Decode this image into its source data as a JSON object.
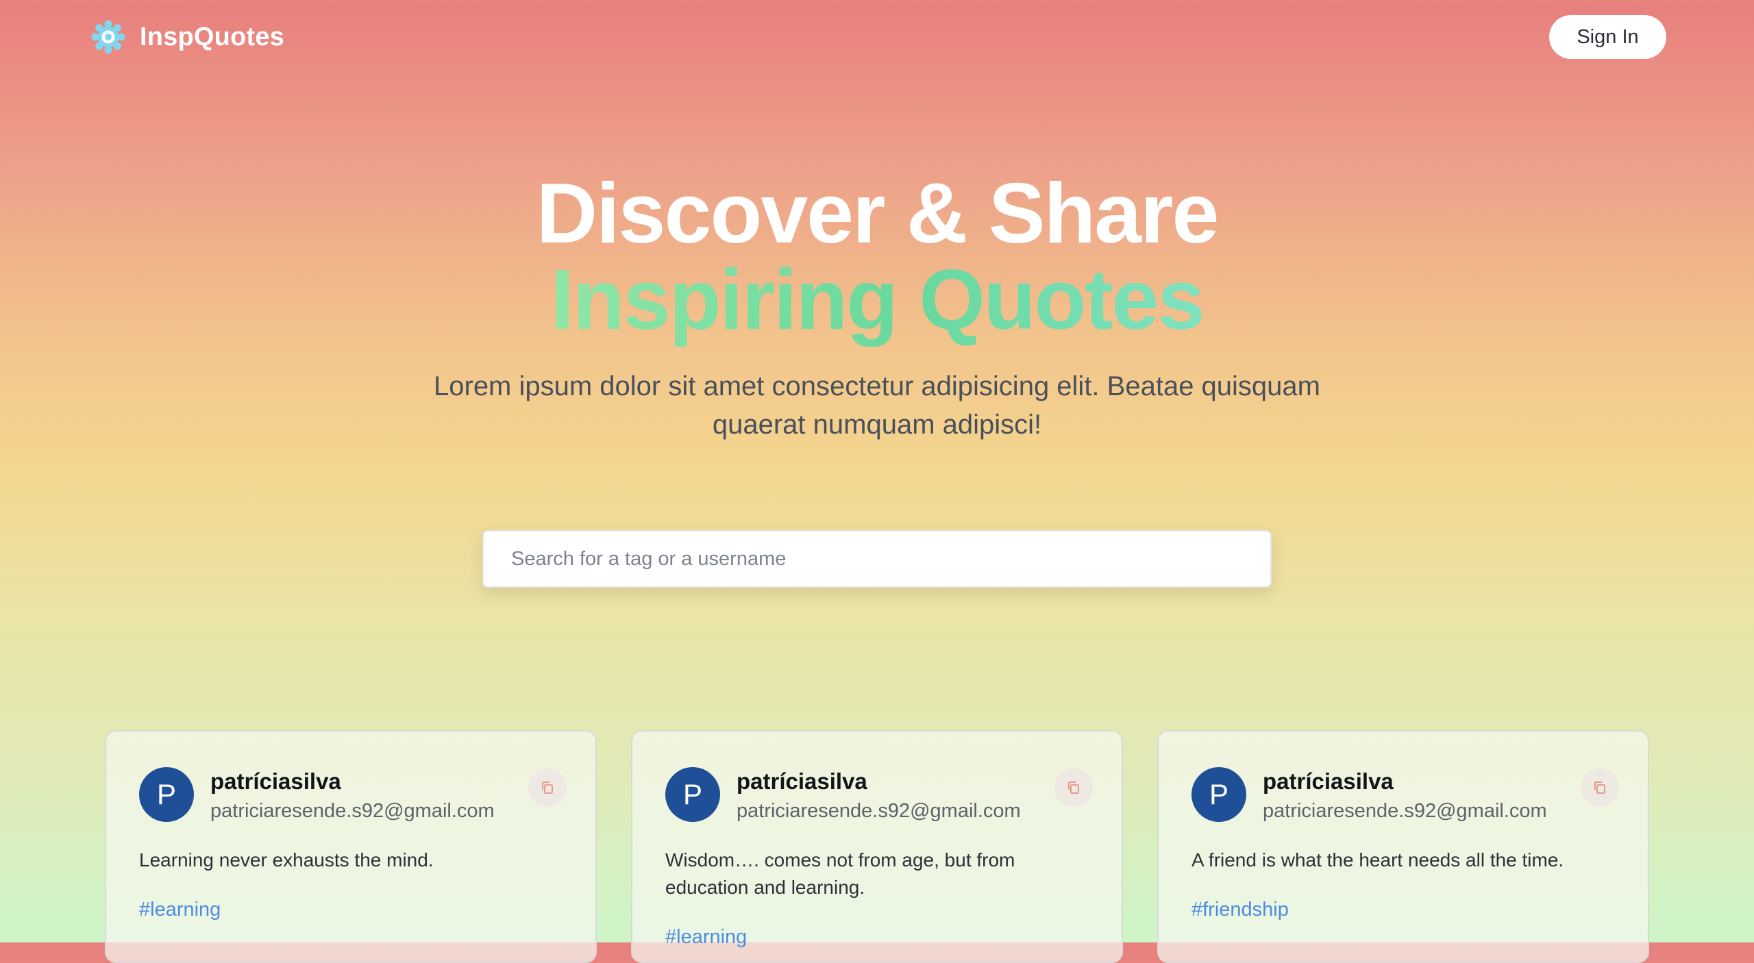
{
  "nav": {
    "brand": "InspQuotes",
    "sign_in": "Sign In"
  },
  "hero": {
    "title_line1": "Discover & Share",
    "title_line2": "Inspiring Quotes",
    "subtitle": "Lorem ipsum dolor sit amet consectetur adipisicing elit. Beatae quisquam quaerat numquam adipisci!"
  },
  "search": {
    "placeholder": "Search for a tag or a username"
  },
  "cards": [
    {
      "avatar_letter": "P",
      "username": "patríciasilva",
      "email": "patriciaresende.s92@gmail.com",
      "quote": "Learning never exhausts the mind.",
      "tag": "#learning"
    },
    {
      "avatar_letter": "P",
      "username": "patríciasilva",
      "email": "patriciaresende.s92@gmail.com",
      "quote": "Wisdom…. comes not from age, but from education and learning.",
      "tag": "#learning"
    },
    {
      "avatar_letter": "P",
      "username": "patríciasilva",
      "email": "patriciaresende.s92@gmail.com",
      "quote": "A friend is what the heart needs all the time.",
      "tag": "#friendship"
    }
  ],
  "colors": {
    "brand_icon": "#7fd8f0",
    "accent_gradient_start": "#8fe6a7",
    "accent_gradient_end": "#68d89d",
    "avatar_bg": "#1f4f96",
    "tag_link": "#4f8be0",
    "copy_icon": "#e8907e"
  },
  "icons": {
    "brand": "gear-flower-icon",
    "copy": "copy-icon"
  }
}
